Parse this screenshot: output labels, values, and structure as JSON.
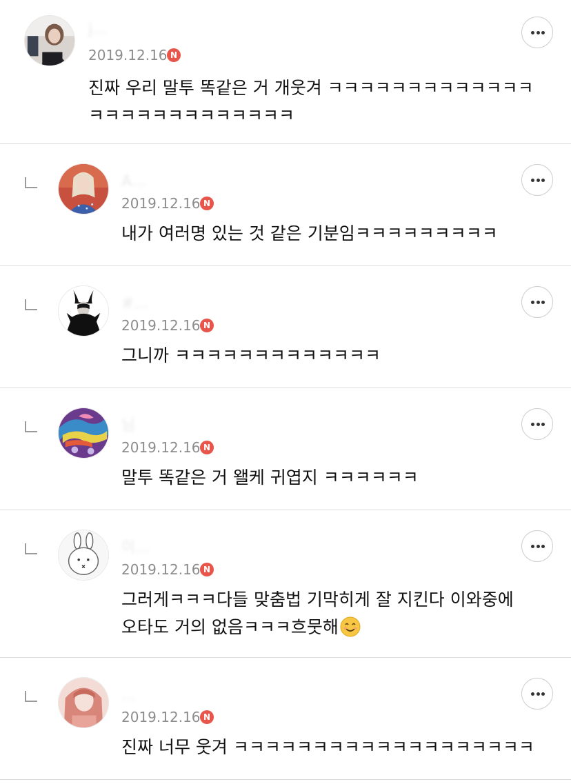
{
  "comments": [
    {
      "username": "j...",
      "date": "2019.12.16",
      "badge": "N",
      "lines": [
        "진짜 우리 말투 똑같은 거 개웃겨 ㅋㅋㅋㅋㅋㅋㅋㅋㅋㅋㅋㅋㅋ",
        "ㅋㅋㅋㅋㅋㅋㅋㅋㅋㅋㅋㅋㅋ"
      ],
      "avatar_icon": "girl-photo-avatar"
    },
    {
      "username": "A...",
      "date": "2019.12.16",
      "badge": "N",
      "lines": [
        "내가 여러명 있는 것 같은 기분임ㅋㅋㅋㅋㅋㅋㅋㅋㅋ"
      ],
      "avatar_icon": "elsa-avatar"
    },
    {
      "username": "#...",
      "date": "2019.12.16",
      "badge": "N",
      "lines": [
        "그니까 ㅋㅋㅋㅋㅋㅋㅋㅋㅋㅋㅋㅋㅋ"
      ],
      "avatar_icon": "maleficent-avatar"
    },
    {
      "username": "님",
      "date": "2019.12.16",
      "badge": "N",
      "lines": [
        "말투 똑같은 거 왤케 귀엽지 ㅋㅋㅋㅋㅋㅋ"
      ],
      "avatar_icon": "colorful-art-avatar"
    },
    {
      "username": "이...",
      "date": "2019.12.16",
      "badge": "N",
      "lines": [
        "그러게ㅋㅋㅋ다들 맞춤법 기막히게 잘 지킨다 이와중에",
        "오타도 거의 없음ㅋㅋㅋ흐뭇해"
      ],
      "emoji": "smiling-face-emoji",
      "avatar_icon": "rabbit-avatar"
    },
    {
      "username": "...",
      "date": "2019.12.16",
      "badge": "N",
      "lines": [
        "진짜 너무 웃겨 ㅋㅋㅋㅋㅋㅋㅋㅋㅋㅋㅋㅋㅋㅋㅋㅋㅋㅋㅋ"
      ],
      "avatar_icon": "girl-selfie-avatar"
    }
  ],
  "more_button_icon": "more-horizontal-icon",
  "reply_icon": "reply-indent-icon",
  "colors": {
    "badge": "#e8554b",
    "date": "#8c8c8c",
    "divider": "#dcdcdc",
    "text": "#111111"
  }
}
